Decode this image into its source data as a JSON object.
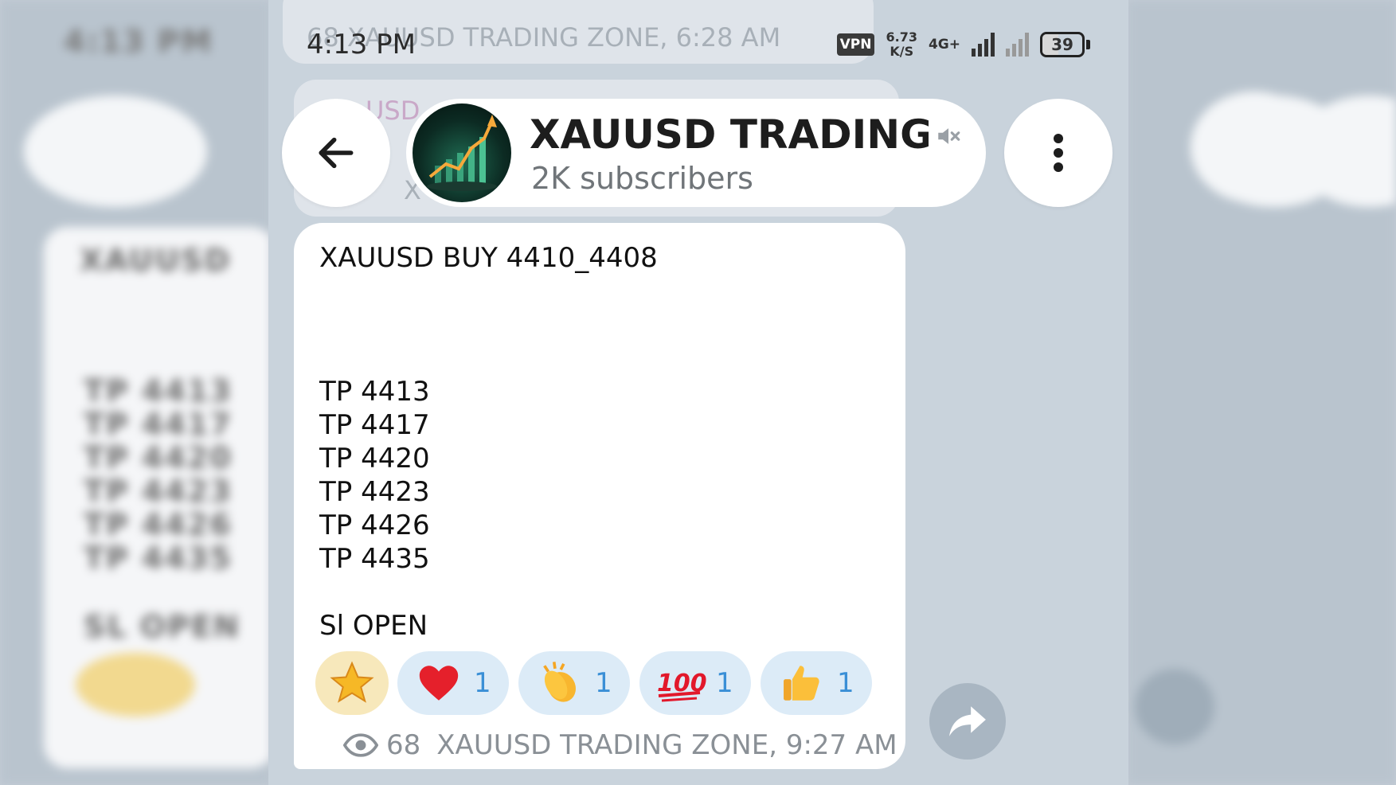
{
  "status_bar": {
    "time": "4:13 PM",
    "vpn": "VPN",
    "speed_value": "6.73",
    "speed_unit": "K/S",
    "network": "4G+",
    "battery": "39"
  },
  "ghost": {
    "top_text": "68 XAUUSD TRADING ZONE, 6:28 AM",
    "prev_label_a": "USD",
    "prev_label_b": "X"
  },
  "header": {
    "back_icon": "arrow-left-icon",
    "channel_title": "XAUUSD TRADING ZONE",
    "subscribers": "2K subscribers",
    "mute_icon": "speaker-mute-icon",
    "menu_icon": "more-vertical-icon"
  },
  "message": {
    "headline": "XAUUSD BUY 4410_4408",
    "targets": [
      "TP 4413",
      "TP 4417",
      "TP 4420",
      "TP 4423",
      "TP 4426",
      "TP 4435"
    ],
    "sl": "Sl  OPEN",
    "reactions": [
      {
        "emoji": "star",
        "count": ""
      },
      {
        "emoji": "heart",
        "count": "1"
      },
      {
        "emoji": "clapping-hands",
        "count": "1"
      },
      {
        "emoji": "hundred-points",
        "count": "1"
      },
      {
        "emoji": "thumbs-up",
        "count": "1"
      }
    ],
    "views": "68",
    "author_time": "XAUUSD TRADING ZONE, 9:27 AM"
  },
  "colors": {
    "background": "#c9d3dc",
    "bubble": "#ffffff",
    "reaction_bg": "#dcebf7",
    "reaction_count": "#3a8fd6",
    "meta_text": "#8a9096"
  }
}
